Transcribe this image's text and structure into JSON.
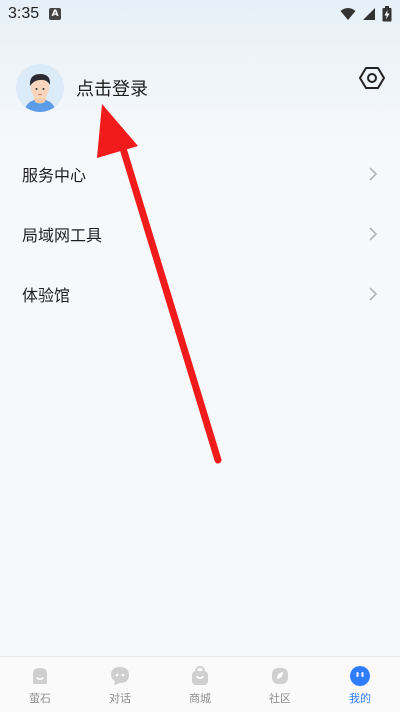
{
  "status_bar": {
    "time": "3:35",
    "app_indicator": "A",
    "icons": [
      "wifi-icon",
      "signal-icon",
      "battery-charging-icon"
    ]
  },
  "profile": {
    "login_label": "点击登录",
    "avatar_icon": "user-avatar",
    "settings_icon": "gear-hexagon-icon"
  },
  "menu": {
    "items": [
      {
        "label": "服务中心",
        "icon": "chevron-right-icon"
      },
      {
        "label": "局域网工具",
        "icon": "chevron-right-icon"
      },
      {
        "label": "体验馆",
        "icon": "chevron-right-icon"
      }
    ]
  },
  "tabbar": {
    "tabs": [
      {
        "label": "萤石",
        "icon": "home-bubble-icon",
        "active": false
      },
      {
        "label": "对话",
        "icon": "chat-bubble-icon",
        "active": false
      },
      {
        "label": "商城",
        "icon": "shopping-bag-icon",
        "active": false
      },
      {
        "label": "社区",
        "icon": "community-icon",
        "active": false
      },
      {
        "label": "我的",
        "icon": "profile-face-icon",
        "active": true
      }
    ],
    "active_color": "#2f7dff",
    "inactive_color": "#8f8f8f"
  },
  "annotation": {
    "arrow_color": "#f21b1b"
  }
}
